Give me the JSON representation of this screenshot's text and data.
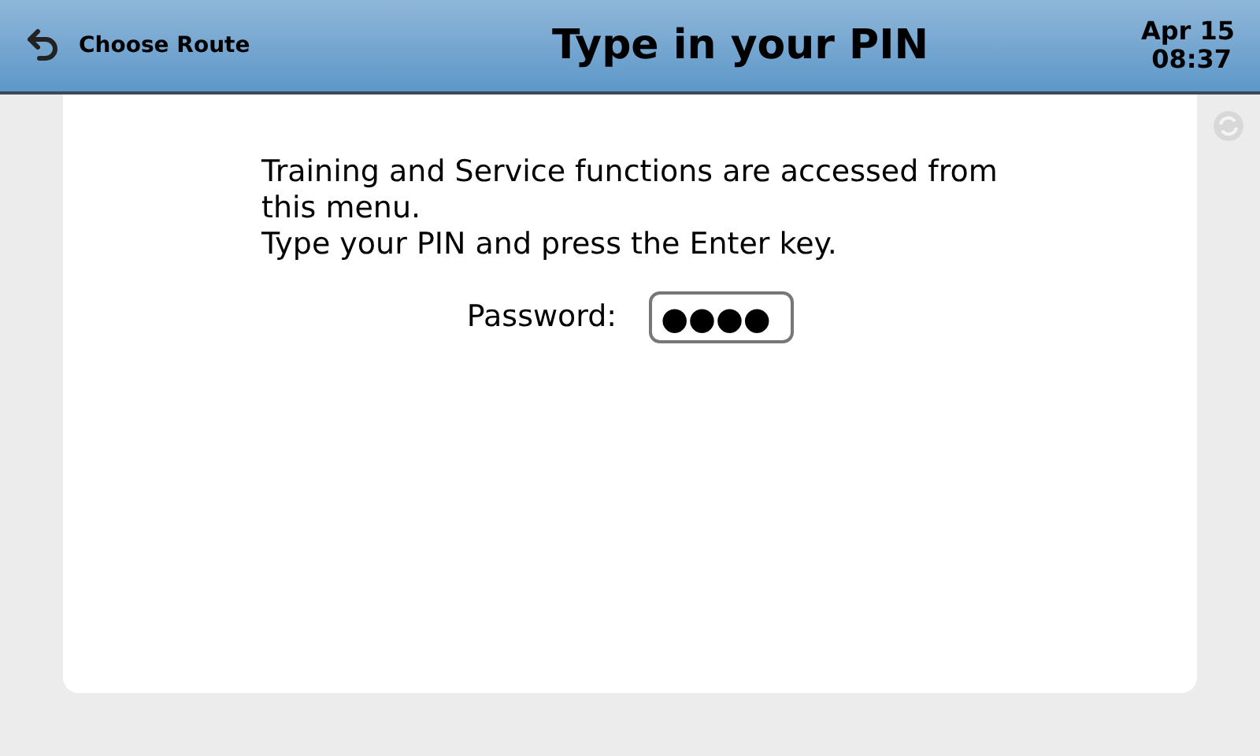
{
  "header": {
    "back_label": "Choose Route",
    "title": "Type in your PIN",
    "date": "Apr 15",
    "time": "08:37"
  },
  "message": [
    "Training and Service functions are accessed from this menu.",
    "Type your PIN and press the Enter key."
  ],
  "password": {
    "label": "Password:",
    "value": "●●●●"
  }
}
